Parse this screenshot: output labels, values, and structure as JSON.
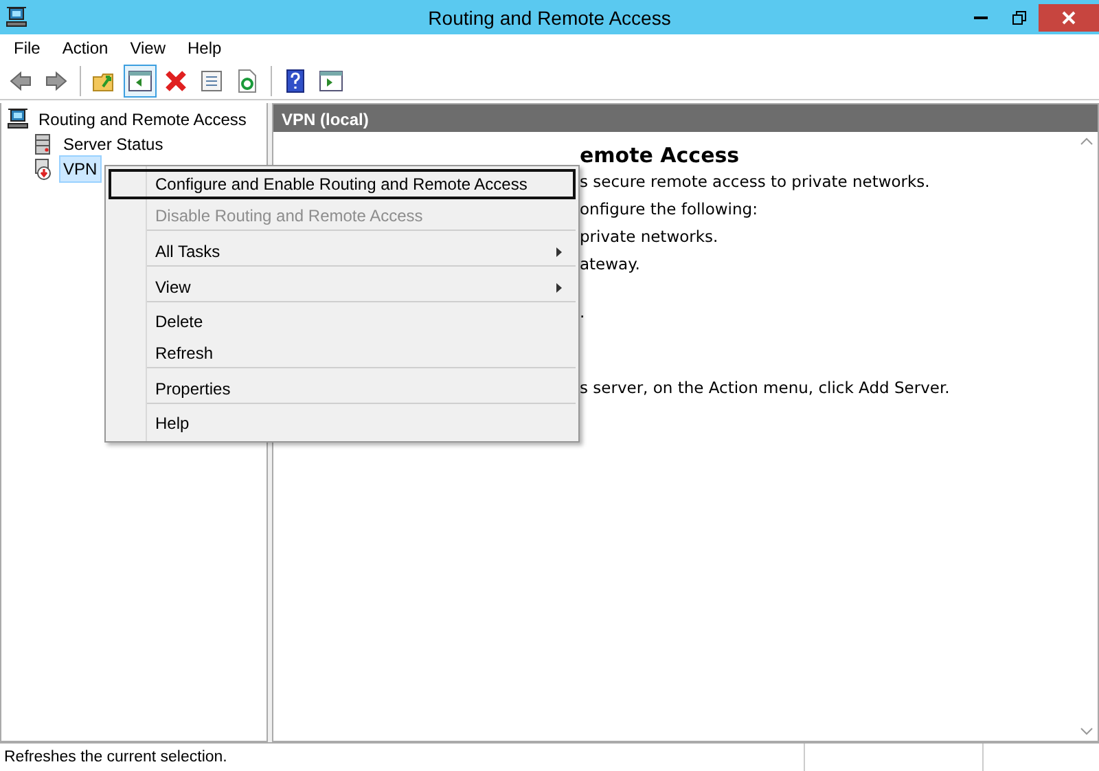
{
  "window": {
    "title": "Routing and Remote Access"
  },
  "menu_bar": [
    "File",
    "Action",
    "View",
    "Help"
  ],
  "toolbar": [
    {
      "kind": "back",
      "pressed": false
    },
    {
      "kind": "forward",
      "pressed": false
    },
    {
      "kind": "up",
      "pressed": false
    },
    {
      "kind": "tree",
      "pressed": true
    },
    {
      "kind": "delete",
      "pressed": false
    },
    {
      "kind": "properties",
      "pressed": false
    },
    {
      "kind": "refresh",
      "pressed": false
    },
    {
      "kind": "help",
      "pressed": false
    },
    {
      "kind": "pane",
      "pressed": false
    }
  ],
  "tree": [
    {
      "label": "Routing and Remote Access",
      "kind": "server",
      "selected": false,
      "children": [
        {
          "label": "Server Status",
          "kind": "status",
          "selected": false
        },
        {
          "label": "VPN",
          "kind": "vpn",
          "selected": true
        }
      ]
    }
  ],
  "pane": {
    "header": "VPN (local)",
    "heading": "emote Access",
    "lines": [
      "s secure remote access to private networks.",
      "onfigure the following:",
      "private networks.",
      "ateway.",
      ".",
      "s server, on the Action menu, click Add Server."
    ]
  },
  "context_menu": [
    {
      "label": "Configure and Enable Routing and Remote Access",
      "disabled": false,
      "submenu": false,
      "selected": true,
      "separator_after": false
    },
    {
      "label": "Disable Routing and Remote Access",
      "disabled": true,
      "submenu": false,
      "selected": false,
      "separator_after": true
    },
    {
      "label": "All Tasks",
      "disabled": false,
      "submenu": true,
      "selected": false,
      "separator_after": true
    },
    {
      "label": "View",
      "disabled": false,
      "submenu": true,
      "selected": false,
      "separator_after": true
    },
    {
      "label": "Delete",
      "disabled": false,
      "submenu": false,
      "selected": false,
      "separator_after": false
    },
    {
      "label": "Refresh",
      "disabled": false,
      "submenu": false,
      "selected": false,
      "separator_after": true
    },
    {
      "label": "Properties",
      "disabled": false,
      "submenu": false,
      "selected": false,
      "separator_after": true
    },
    {
      "label": "Help",
      "disabled": false,
      "submenu": false,
      "selected": false,
      "separator_after": false
    }
  ],
  "status_bar": "Refreshes the current selection."
}
